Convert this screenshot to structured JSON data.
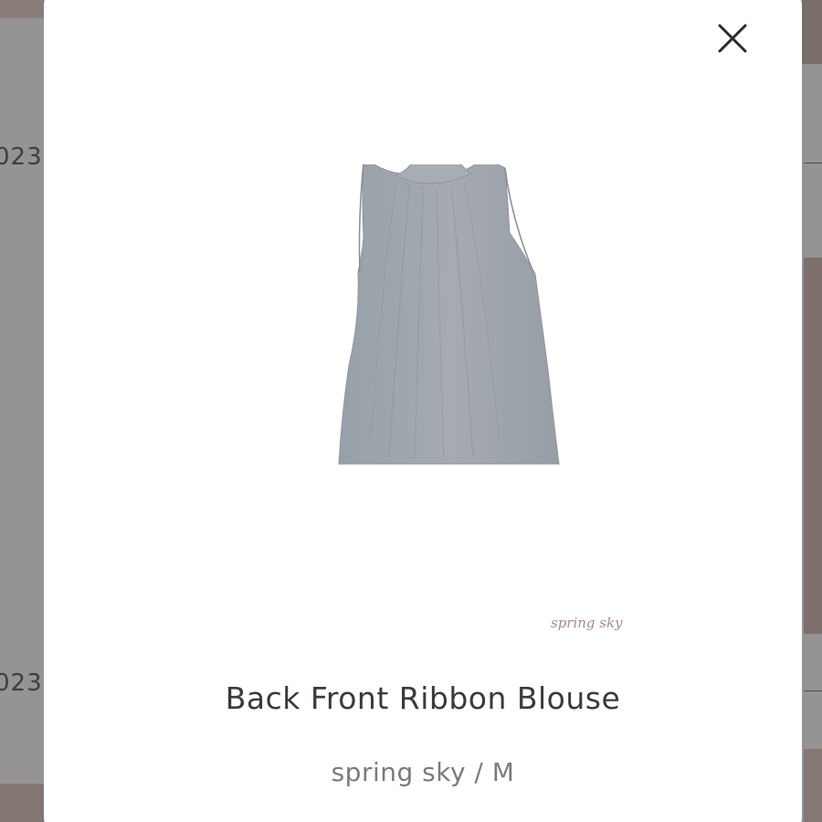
{
  "background": {
    "year_top": "023",
    "year_bottom": "023"
  },
  "modal": {
    "close_icon": "close-icon",
    "product": {
      "image_icon": "sleeveless-blouse-image",
      "watermark": "spring sky",
      "name": "Back Front Ribbon Blouse",
      "variant": "spring sky / M"
    }
  },
  "colors": {
    "overlay": "#969493",
    "modal_bg": "#ffffff",
    "title_text": "#3a3a3a",
    "variant_text": "#7b7b7b",
    "watermark_text": "#a58b8f",
    "blouse": "#9ea3aa"
  }
}
